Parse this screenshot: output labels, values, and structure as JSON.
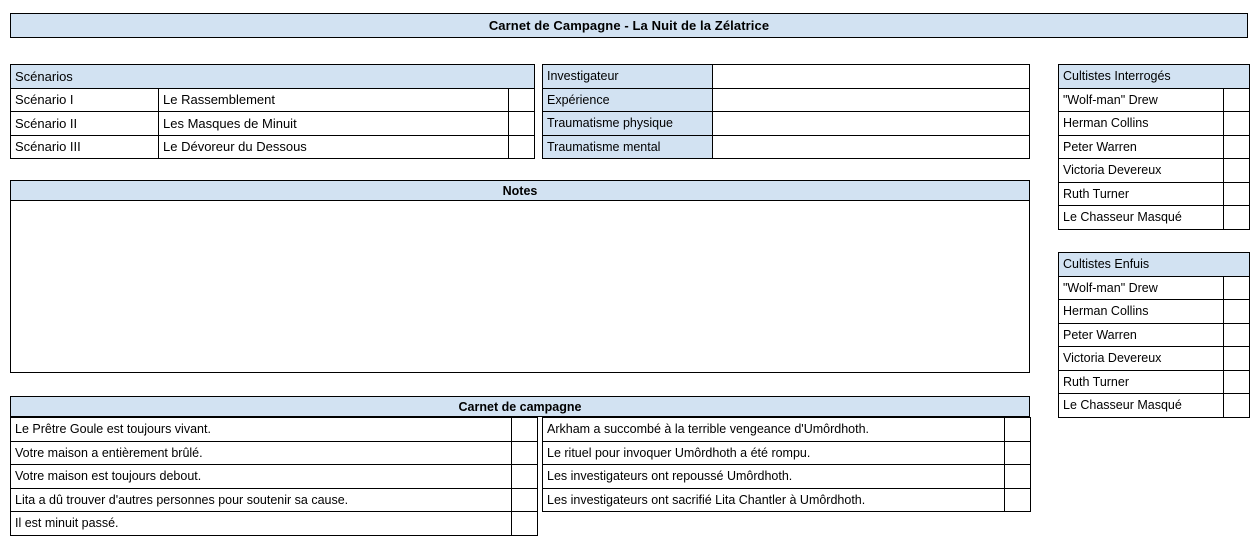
{
  "title": {
    "text": "Carnet de Campagne - La Nuit de la Zélatrice"
  },
  "scenarios": {
    "header": "Scénarios",
    "rows": [
      {
        "num": "Scénario I",
        "name": "Le Rassemblement",
        "check": ""
      },
      {
        "num": "Scénario II",
        "name": "Les Masques de Minuit",
        "check": ""
      },
      {
        "num": "Scénario III",
        "name": "Le Dévoreur du Dessous",
        "check": ""
      }
    ]
  },
  "investigator": {
    "rows": [
      {
        "label": "Investigateur",
        "value": ""
      },
      {
        "label": "Expérience",
        "value": ""
      },
      {
        "label": "Traumatisme physique",
        "value": ""
      },
      {
        "label": "Traumatisme mental",
        "value": ""
      }
    ]
  },
  "notes": {
    "header": "Notes",
    "value": ""
  },
  "cultists_interrogated": {
    "header": "Cultistes Interrogés",
    "rows": [
      {
        "name": "\"Wolf-man\" Drew",
        "check": ""
      },
      {
        "name": "Herman Collins",
        "check": ""
      },
      {
        "name": "Peter Warren",
        "check": ""
      },
      {
        "name": "Victoria Devereux",
        "check": ""
      },
      {
        "name": "Ruth Turner",
        "check": ""
      },
      {
        "name": "Le Chasseur Masqué",
        "check": ""
      }
    ]
  },
  "cultists_fled": {
    "header": "Cultistes Enfuis",
    "rows": [
      {
        "name": "\"Wolf-man\" Drew",
        "check": ""
      },
      {
        "name": "Herman Collins",
        "check": ""
      },
      {
        "name": "Peter Warren",
        "check": ""
      },
      {
        "name": "Victoria Devereux",
        "check": ""
      },
      {
        "name": "Ruth Turner",
        "check": ""
      },
      {
        "name": "Le Chasseur Masqué",
        "check": ""
      }
    ]
  },
  "carnet": {
    "header": "Carnet de campagne",
    "left_rows": [
      {
        "text": "Le Prêtre Goule est toujours vivant.",
        "check": ""
      },
      {
        "text": "Votre maison a entièrement brûlé.",
        "check": ""
      },
      {
        "text": "Votre maison est toujours debout.",
        "check": ""
      },
      {
        "text": "Lita a dû trouver d'autres personnes pour soutenir sa cause.",
        "check": ""
      },
      {
        "text": "Il est minuit passé.",
        "check": ""
      }
    ],
    "right_rows": [
      {
        "text": "Arkham a succombé à la terrible vengeance d'Umôrdhoth.",
        "check": ""
      },
      {
        "text": "Le rituel pour invoquer Umôrdhoth a été rompu.",
        "check": ""
      },
      {
        "text": "Les investigateurs ont repoussé Umôrdhoth.",
        "check": ""
      },
      {
        "text": "Les investigateurs ont sacrifié Lita Chantler à Umôrdhoth.",
        "check": ""
      }
    ]
  },
  "colors": {
    "header_blue": "#d2e2f2",
    "border": "#000000",
    "page_background": "#ffffff"
  }
}
